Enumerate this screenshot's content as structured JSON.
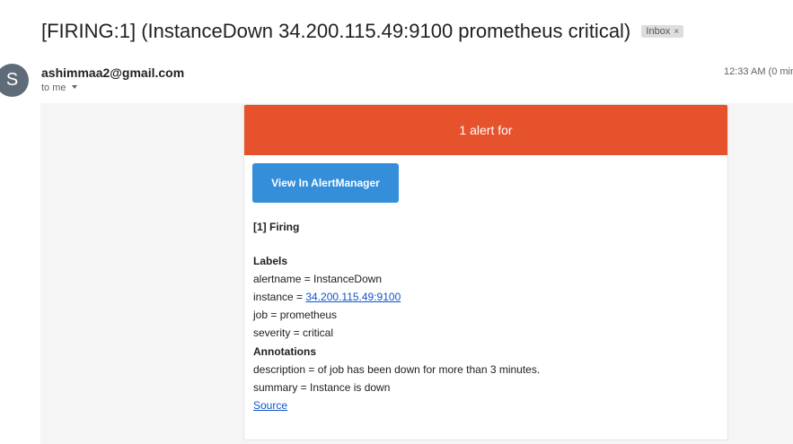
{
  "subject": "[FIRING:1] (InstanceDown 34.200.115.49:9100 prometheus critical)",
  "label_chip": "Inbox",
  "label_chip_close": "×",
  "avatar_letter": "S",
  "sender": "ashimmaa2@gmail.com",
  "recipient": "to me",
  "timestamp": "12:33 AM (0 min",
  "email": {
    "banner": "1 alert for",
    "button": "View In AlertManager",
    "firing": "[1] Firing",
    "labels_heading": "Labels",
    "alertname": "alertname = InstanceDown",
    "instance_prefix": "instance = ",
    "instance_link": "34.200.115.49:9100",
    "job": "job = prometheus",
    "severity": "severity = critical",
    "annotations_heading": "Annotations",
    "description": "description = of job has been down for more than 3 minutes.",
    "summary": "summary = Instance is down",
    "source_link": "Source"
  },
  "colors": {
    "banner": "#e6522c",
    "button": "#348eda",
    "link": "#1155cc",
    "avatar": "#5f6b78"
  }
}
